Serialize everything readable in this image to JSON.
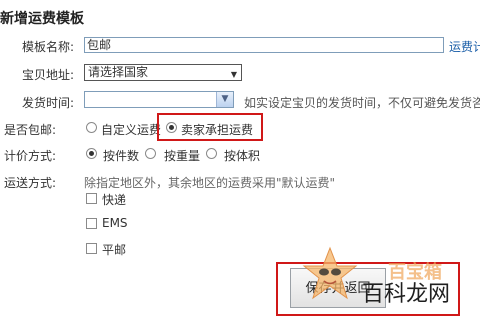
{
  "page_title": "新增运费模板",
  "form": {
    "template_name": {
      "label": "模板名称:",
      "value": "包邮",
      "side_link": "运费计"
    },
    "location": {
      "label": "宝贝地址:",
      "value": "请选择国家"
    },
    "ship_time": {
      "label": "发货时间:",
      "value": "",
      "note": "如实设定宝贝的发货时间，不仅可避免发货咨"
    },
    "free_shipping": {
      "label": "是否包邮:",
      "options": [
        {
          "label": "自定义运费",
          "checked": false
        },
        {
          "label": "卖家承担运费",
          "checked": true
        }
      ]
    },
    "pricing": {
      "label": "计价方式:",
      "options": [
        {
          "label": "按件数",
          "checked": true
        },
        {
          "label": "按重量",
          "checked": false
        },
        {
          "label": "按体积",
          "checked": false
        }
      ]
    },
    "delivery": {
      "label": "运送方式:",
      "note": "除指定地区外，其余地区的运费采用\"默认运费\"",
      "methods": [
        {
          "label": "快递",
          "checked": false
        },
        {
          "label": "EMS",
          "checked": false
        },
        {
          "label": "平邮",
          "checked": false
        }
      ]
    }
  },
  "save_button": {
    "label": "保存并返回"
  },
  "watermark": {
    "text_1": "百宝箱",
    "text_2": "百科龙网"
  },
  "highlight_color": "#d01818"
}
